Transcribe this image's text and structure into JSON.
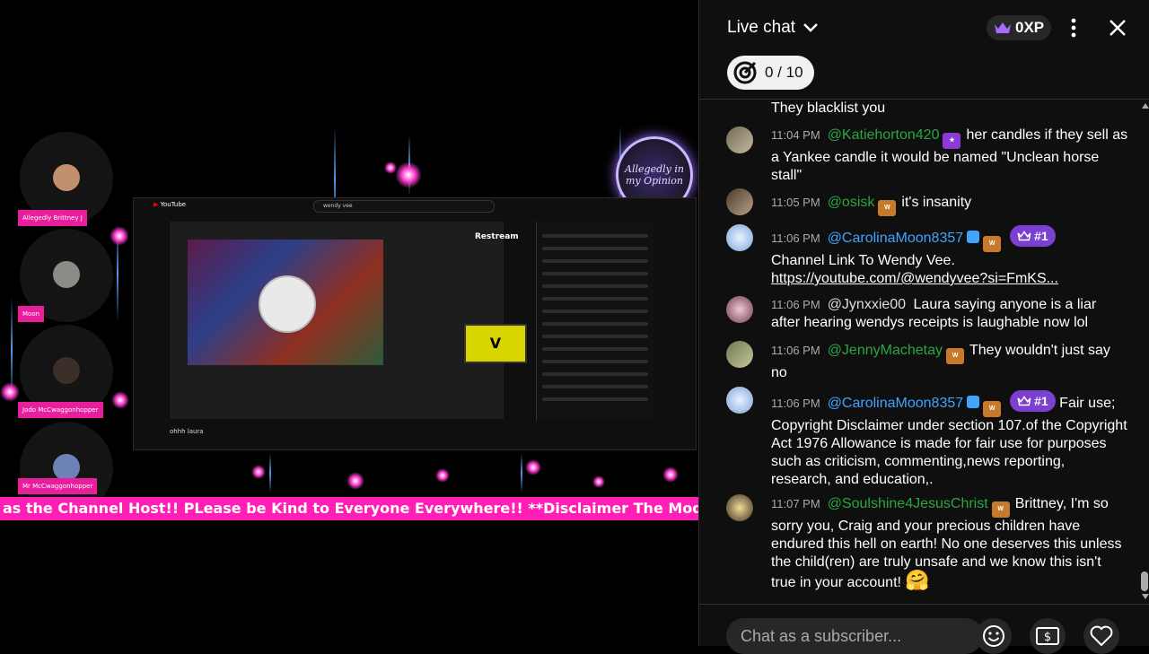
{
  "stage": {
    "guests": [
      {
        "name": "Allegedly Brittney J"
      },
      {
        "name": "Moon"
      },
      {
        "name": "Jodo McCwaggonhopper"
      },
      {
        "name": "Mr McCwaggonhopper"
      }
    ],
    "logo_text": "Allegedly in my Opinion",
    "share": {
      "yt_logo": "YouTube",
      "search_query": "wendy vee",
      "restream_label": "Restream",
      "vbox_label": "V",
      "video_title": "ohhh laura"
    },
    "ticker_text": "as the Channel Host!! PLease be Kind to Everyone Everywhere!! **Disclaimer The Moderators Main"
  },
  "chat": {
    "title": "Live chat",
    "xp_label": "0XP",
    "goal": "0 / 10",
    "input_placeholder": "Chat as a subscriber...",
    "messages": [
      {
        "text": "They blacklist you"
      },
      {
        "time": "11:04 PM",
        "author": "@Katiehorton420",
        "text": "her candles if they sell as a Yankee candle it would be named \"Unclean horse stall\""
      },
      {
        "time": "11:05 PM",
        "author": "@osisk",
        "text": "it's insanity"
      },
      {
        "time": "11:06 PM",
        "author": "@CarolinaMoon8357",
        "rank": "#1",
        "text": "Channel Link To Wendy Vee.",
        "link": "https://youtube.com/@wendyvee?si=FmKS..."
      },
      {
        "time": "11:06 PM",
        "author": "@Jynxxie00",
        "text": "Laura saying anyone is a liar after hearing wendys receipts is laughable now lol"
      },
      {
        "time": "11:06 PM",
        "author": "@JennyMachetay",
        "text": "They wouldn't just say no"
      },
      {
        "time": "11:06 PM",
        "author": "@CarolinaMoon8357",
        "rank": "#1",
        "text": "Fair use; Copyright Disclaimer under section 107.of the Copyright Act 1976 Allowance is made for fair use for purposes such as criticism, commenting,news reporting, research, and education,."
      },
      {
        "time": "11:07 PM",
        "author": "@Soulshine4JesusChrist",
        "text": "Brittney, I'm so sorry you, Craig and your precious children have endured this hell on earth! No one deserves this unless the child(ren) are truly unsafe and we know this isn't true in your account!",
        "emoji": "🤗"
      }
    ]
  },
  "colors": {
    "ticker": "#ff1fb4",
    "rank_badge": "#7b3fd2",
    "author_green": "#2ba640",
    "owner_blue": "#3ea6ff"
  }
}
